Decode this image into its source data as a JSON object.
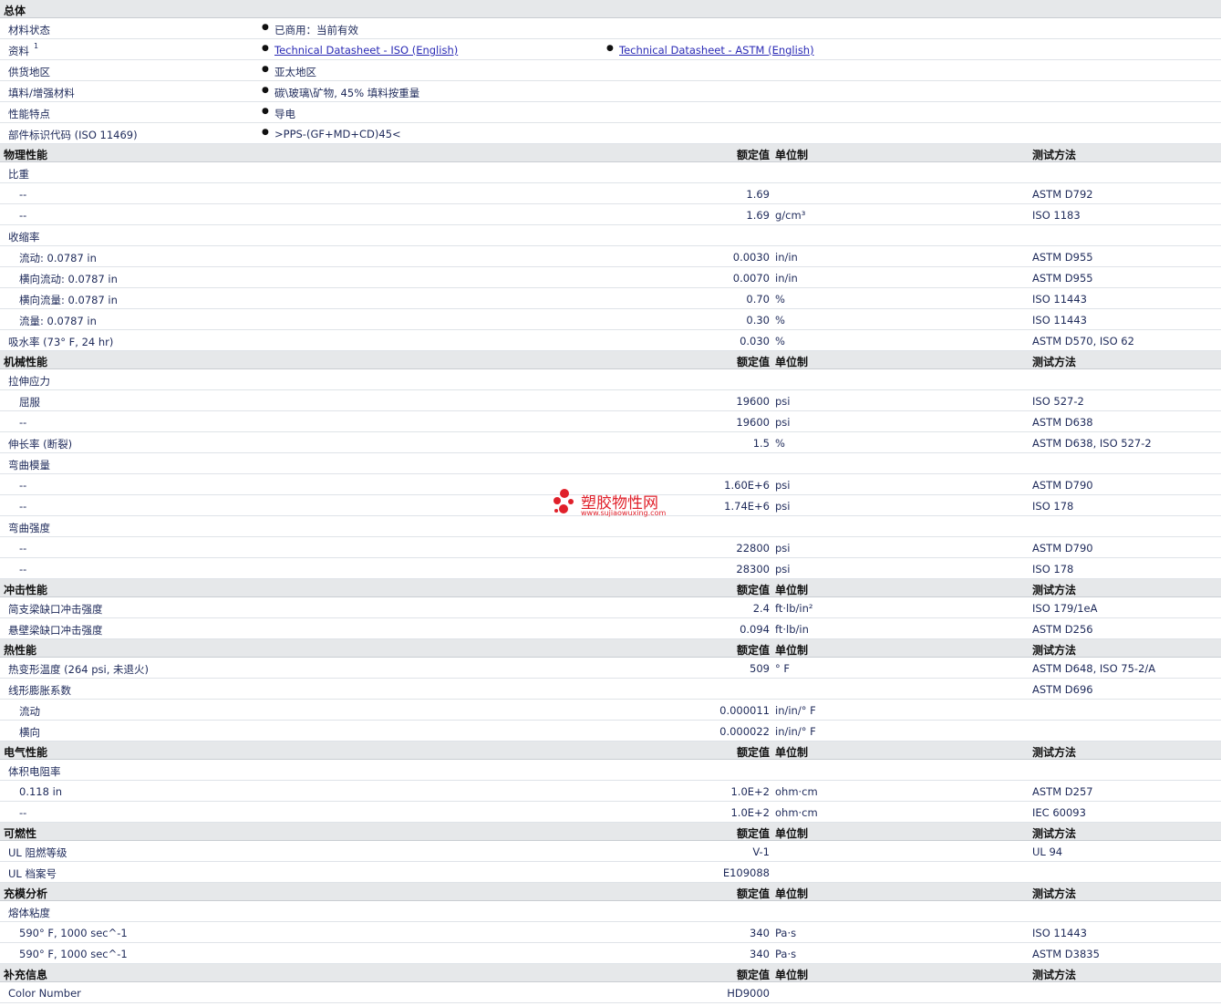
{
  "sections": [
    {
      "type": "general",
      "title": "总体",
      "rows": [
        {
          "label": "材料状态",
          "values": [
            "已商用：当前有效"
          ]
        },
        {
          "label": "资料",
          "sup": "1",
          "links": [
            "Technical Datasheet - ISO (English)",
            "Technical Datasheet - ASTM (English)"
          ]
        },
        {
          "label": "供货地区",
          "values": [
            "亚太地区"
          ]
        },
        {
          "label": "填料/增强材料",
          "values": [
            "碳\\玻璃\\矿物, 45% 填料按重量"
          ]
        },
        {
          "label": "性能特点",
          "values": [
            "导电"
          ]
        },
        {
          "label": "部件标识代码 (ISO 11469)",
          "values": [
            ">PPS-(GF+MD+CD)45<"
          ]
        }
      ]
    },
    {
      "type": "props",
      "title": "物理性能",
      "h1": "额定值",
      "h2": "单位制",
      "h3": "测试方法",
      "rows": [
        {
          "label": "比重",
          "val": "",
          "unit": "",
          "meth": ""
        },
        {
          "label": "--",
          "indent": true,
          "val": "1.69",
          "unit": "",
          "meth": "ASTM D792"
        },
        {
          "label": "--",
          "indent": true,
          "val": "1.69",
          "unit": "g/cm³",
          "meth": "ISO 1183"
        },
        {
          "label": "收缩率",
          "val": "",
          "unit": "",
          "meth": ""
        },
        {
          "label": "流动: 0.0787 in",
          "indent": true,
          "val": "0.0030",
          "unit": "in/in",
          "meth": "ASTM D955"
        },
        {
          "label": "横向流动: 0.0787 in",
          "indent": true,
          "val": "0.0070",
          "unit": "in/in",
          "meth": "ASTM D955"
        },
        {
          "label": "横向流量: 0.0787 in",
          "indent": true,
          "val": "0.70",
          "unit": "%",
          "meth": "ISO 11443"
        },
        {
          "label": "流量: 0.0787 in",
          "indent": true,
          "val": "0.30",
          "unit": "%",
          "meth": "ISO 11443"
        },
        {
          "label": "吸水率 (73° F, 24 hr)",
          "val": "0.030",
          "unit": "%",
          "meth": "ASTM D570, ISO 62"
        }
      ]
    },
    {
      "type": "props",
      "title": "机械性能",
      "h1": "额定值",
      "h2": "单位制",
      "h3": "测试方法",
      "rows": [
        {
          "label": "拉伸应力",
          "val": "",
          "unit": "",
          "meth": ""
        },
        {
          "label": "屈服",
          "indent": true,
          "val": "19600",
          "unit": "psi",
          "meth": "ISO 527-2"
        },
        {
          "label": "--",
          "indent": true,
          "val": "19600",
          "unit": "psi",
          "meth": "ASTM D638"
        },
        {
          "label": "伸长率 (断裂)",
          "val": "1.5",
          "unit": "%",
          "meth": "ASTM D638, ISO 527-2"
        },
        {
          "label": "弯曲模量",
          "val": "",
          "unit": "",
          "meth": ""
        },
        {
          "label": "--",
          "indent": true,
          "val": "1.60E+6",
          "unit": "psi",
          "meth": "ASTM D790"
        },
        {
          "label": "--",
          "indent": true,
          "val": "1.74E+6",
          "unit": "psi",
          "meth": "ISO 178"
        },
        {
          "label": "弯曲强度",
          "val": "",
          "unit": "",
          "meth": ""
        },
        {
          "label": "--",
          "indent": true,
          "val": "22800",
          "unit": "psi",
          "meth": "ASTM D790"
        },
        {
          "label": "--",
          "indent": true,
          "val": "28300",
          "unit": "psi",
          "meth": "ISO 178"
        }
      ]
    },
    {
      "type": "props",
      "title": "冲击性能",
      "h1": "额定值",
      "h2": "单位制",
      "h3": "测试方法",
      "rows": [
        {
          "label": "简支梁缺口冲击强度",
          "val": "2.4",
          "unit": "ft·lb/in²",
          "meth": "ISO 179/1eA"
        },
        {
          "label": "悬壁梁缺口冲击强度",
          "val": "0.094",
          "unit": "ft·lb/in",
          "meth": "ASTM D256"
        }
      ]
    },
    {
      "type": "props",
      "title": "热性能",
      "h1": "额定值",
      "h2": "单位制",
      "h3": "测试方法",
      "rows": [
        {
          "label": "热变形温度 (264 psi, 未退火)",
          "val": "509",
          "unit": "° F",
          "meth": "ASTM D648, ISO 75-2/A"
        },
        {
          "label": "线形膨胀系数",
          "val": "",
          "unit": "",
          "meth": "ASTM D696"
        },
        {
          "label": "流动",
          "indent": true,
          "val": "0.000011",
          "unit": "in/in/° F",
          "meth": ""
        },
        {
          "label": "横向",
          "indent": true,
          "val": "0.000022",
          "unit": "in/in/° F",
          "meth": ""
        }
      ]
    },
    {
      "type": "props",
      "title": "电气性能",
      "h1": "额定值",
      "h2": "单位制",
      "h3": "测试方法",
      "rows": [
        {
          "label": "体积电阻率",
          "val": "",
          "unit": "",
          "meth": ""
        },
        {
          "label": "0.118 in",
          "indent": true,
          "val": "1.0E+2",
          "unit": "ohm·cm",
          "meth": "ASTM D257"
        },
        {
          "label": "--",
          "indent": true,
          "val": "1.0E+2",
          "unit": "ohm·cm",
          "meth": "IEC 60093"
        }
      ]
    },
    {
      "type": "props",
      "title": "可燃性",
      "h1": "额定值",
      "h2": "单位制",
      "h3": "测试方法",
      "rows": [
        {
          "label": "UL 阻燃等级",
          "val": "V-1",
          "unit": "",
          "meth": "UL 94"
        },
        {
          "label": "UL 档案号",
          "val": "E109088",
          "unit": "",
          "meth": ""
        }
      ]
    },
    {
      "type": "props",
      "title": "充模分析",
      "h1": "额定值",
      "h2": "单位制",
      "h3": "测试方法",
      "rows": [
        {
          "label": "熔体粘度",
          "val": "",
          "unit": "",
          "meth": ""
        },
        {
          "label": "590° F, 1000 sec^-1",
          "indent": true,
          "val": "340",
          "unit": "Pa·s",
          "meth": "ISO 11443"
        },
        {
          "label": "590° F, 1000 sec^-1",
          "indent": true,
          "val": "340",
          "unit": "Pa·s",
          "meth": "ASTM D3835"
        }
      ]
    },
    {
      "type": "props",
      "title": "补充信息",
      "h1": "额定值",
      "h2": "单位制",
      "h3": "测试方法",
      "rows": [
        {
          "label": "Color Number",
          "val": "HD9000",
          "unit": "",
          "meth": ""
        }
      ]
    }
  ],
  "watermark": {
    "title": "塑胶物性网",
    "sub": "www.sujiaowuxing.com",
    "color": "#e0202a"
  }
}
